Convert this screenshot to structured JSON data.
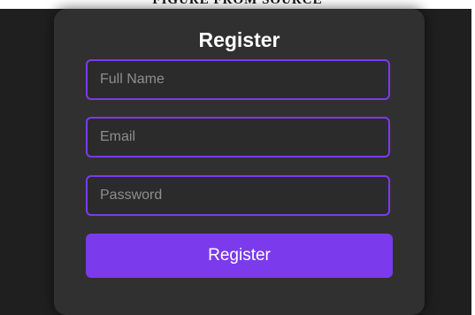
{
  "header_strip": {
    "text": "FIGURE FROM SOURCE"
  },
  "form": {
    "title": "Register",
    "fields": {
      "full_name": {
        "placeholder": "Full Name",
        "value": ""
      },
      "email": {
        "placeholder": "Email",
        "value": ""
      },
      "password": {
        "placeholder": "Password",
        "value": ""
      }
    },
    "submit_label": "Register"
  },
  "colors": {
    "page_background": "#1f1f1f",
    "card_background": "#303030",
    "accent": "#7c3aed",
    "title_text": "#ffffff",
    "placeholder_text": "#8e8e8e"
  }
}
